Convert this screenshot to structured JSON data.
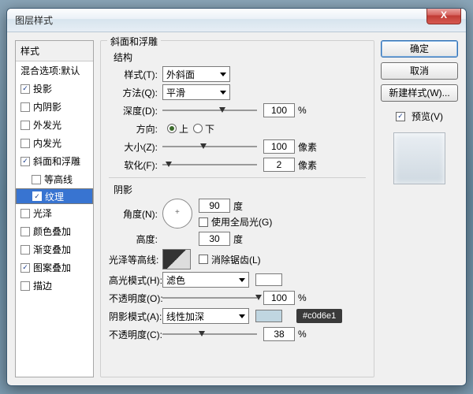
{
  "window": {
    "title": "图层样式"
  },
  "close_glyph": "X",
  "sidebar": {
    "header": "样式",
    "blend": "混合选项:默认",
    "items": [
      {
        "label": "投影",
        "checked": true
      },
      {
        "label": "内阴影",
        "checked": false
      },
      {
        "label": "外发光",
        "checked": false
      },
      {
        "label": "内发光",
        "checked": false
      },
      {
        "label": "斜面和浮雕",
        "checked": true,
        "selected": false
      },
      {
        "label": "等高线",
        "checked": false,
        "sub": true
      },
      {
        "label": "纹理",
        "checked": true,
        "sub": true,
        "selected": true
      },
      {
        "label": "光泽",
        "checked": false
      },
      {
        "label": "颜色叠加",
        "checked": false
      },
      {
        "label": "渐变叠加",
        "checked": false
      },
      {
        "label": "图案叠加",
        "checked": true
      },
      {
        "label": "描边",
        "checked": false
      }
    ]
  },
  "bevel": {
    "group_title": "斜面和浮雕",
    "structure_title": "结构",
    "style_label": "样式(T):",
    "style_value": "外斜面",
    "technique_label": "方法(Q):",
    "technique_value": "平滑",
    "depth_label": "深度(D):",
    "depth_value": "100",
    "depth_pct": "%",
    "direction_label": "方向:",
    "up": "上",
    "down": "下",
    "size_label": "大小(Z):",
    "size_value": "100",
    "px": "像素",
    "soften_label": "软化(F):",
    "soften_value": "2",
    "shading_title": "阴影",
    "angle_label": "角度(N):",
    "angle_value": "90",
    "deg": "度",
    "global_label": "使用全局光(G)",
    "altitude_label": "高度:",
    "altitude_value": "30",
    "gloss_label": "光泽等高线:",
    "aa_label": "消除锯齿(L)",
    "hlmode_label": "高光模式(H):",
    "hlmode_value": "滤色",
    "hl_opacity_label": "不透明度(O):",
    "hl_opacity_value": "100",
    "shmode_label": "阴影模式(A):",
    "shmode_value": "线性加深",
    "sh_opacity_label": "不透明度(C):",
    "sh_opacity_value": "38",
    "sh_color": "#c0d6e1",
    "tooltip": "#c0d6e1"
  },
  "buttons": {
    "ok": "确定",
    "cancel": "取消",
    "newstyle": "新建样式(W)...",
    "preview": "预览(V)"
  },
  "check_glyph": "✓"
}
